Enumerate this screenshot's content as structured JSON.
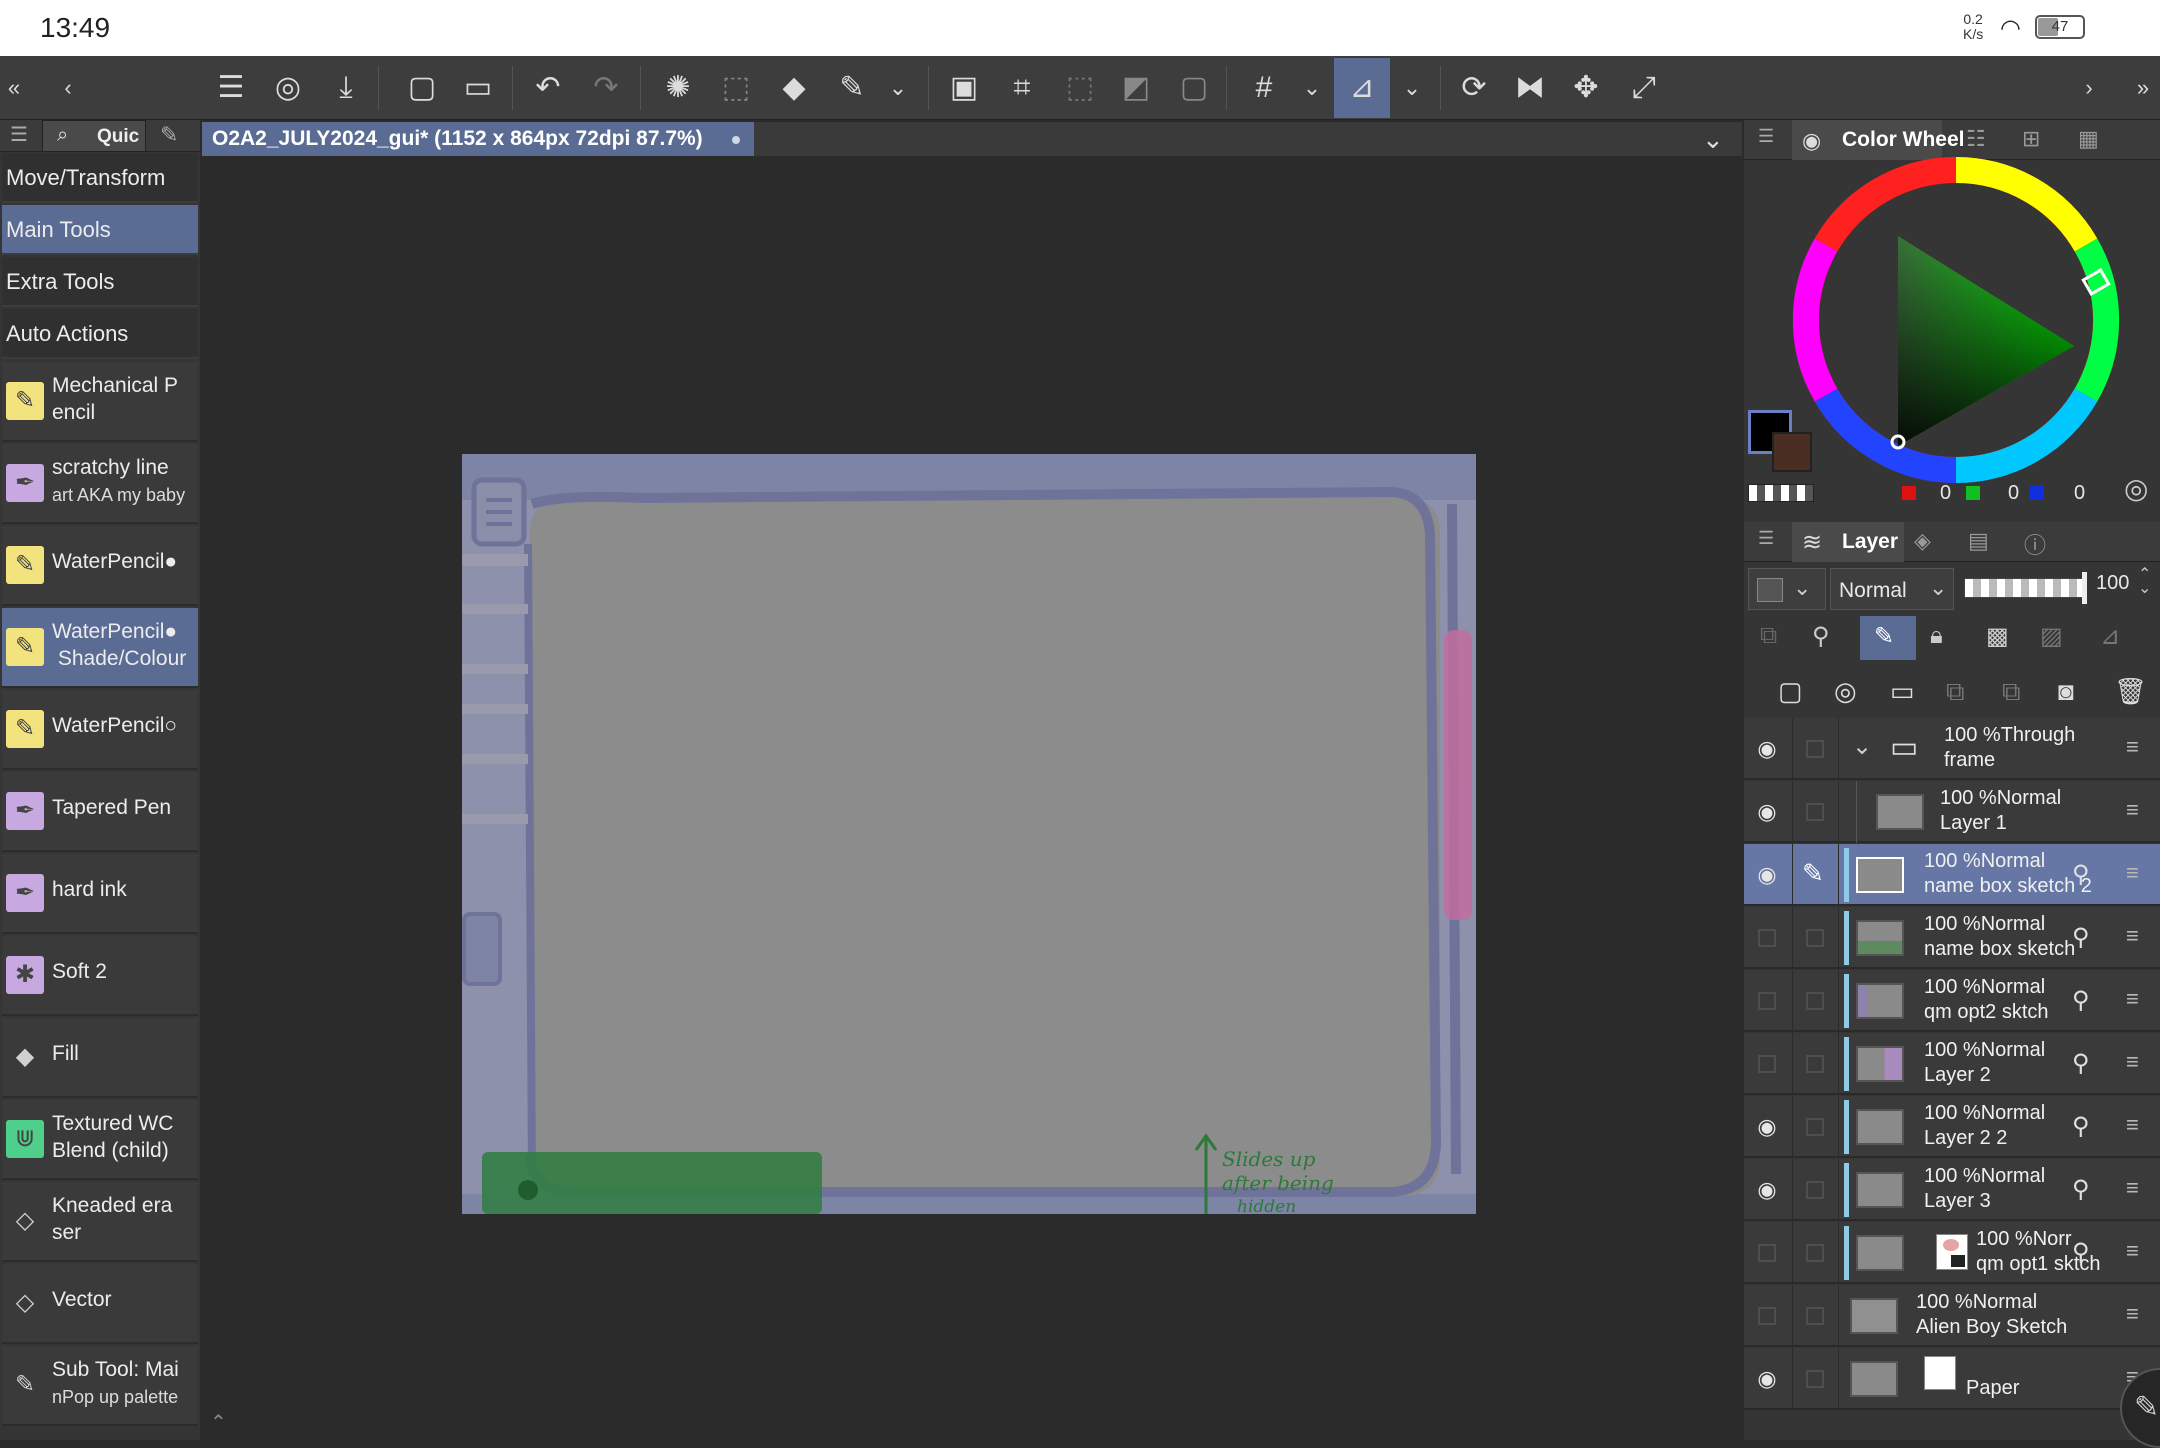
{
  "status_bar": {
    "time": "13:49",
    "net_speed": "0.2",
    "net_unit": "K/s",
    "battery": "47"
  },
  "document": {
    "tab_title": "O2A2_JULY2024_gui* (1152 x 864px 72dpi 87.7%)"
  },
  "left_panel": {
    "tab_label": "Quic",
    "categories": [
      "Move/Transform",
      "Main Tools",
      "Extra Tools",
      "Auto Actions"
    ],
    "tools": [
      {
        "line1": "Mechanical P",
        "line2": "encil"
      },
      {
        "line1": "scratchy line",
        "line2": "art AKA my baby"
      },
      {
        "line1": "WaterPencil●",
        "line2": ""
      },
      {
        "line1": "WaterPencil●",
        "line2": "Shade/Colour"
      },
      {
        "line1": "WaterPencil○",
        "line2": ""
      },
      {
        "line1": "Tapered Pen",
        "line2": ""
      },
      {
        "line1": "hard ink",
        "line2": ""
      },
      {
        "line1": "Soft 2",
        "line2": ""
      },
      {
        "line1": "Fill",
        "line2": ""
      },
      {
        "line1": "Textured WC",
        "line2": "Blend (child)"
      },
      {
        "line1": "Kneaded era",
        "line2": "ser"
      },
      {
        "line1": "Vector",
        "line2": ""
      },
      {
        "line1": "Sub Tool: Mai",
        "line2": "nPop up palette"
      }
    ]
  },
  "color_panel": {
    "title": "Color Wheel",
    "rgb": {
      "r": "0",
      "g": "0",
      "b": "0"
    }
  },
  "layer_panel": {
    "title": "Layer",
    "blend_mode": "Normal",
    "opacity": "100",
    "layers": [
      {
        "line1": "100 %Through",
        "line2": "frame",
        "visible": true,
        "type": "folder"
      },
      {
        "line1": "100 %Normal",
        "line2": "Layer 1",
        "visible": true,
        "type": "child"
      },
      {
        "line1": "100 %Normal",
        "line2": "name box sketch 2",
        "visible": true,
        "type": "clip",
        "selected": true
      },
      {
        "line1": "100 %Normal",
        "line2": "name box sketch",
        "visible": false,
        "type": "clip"
      },
      {
        "line1": "100 %Normal",
        "line2": "qm opt2 sktch",
        "visible": false,
        "type": "clip"
      },
      {
        "line1": "100 %Normal",
        "line2": "Layer 2",
        "visible": false,
        "type": "clip"
      },
      {
        "line1": "100 %Normal",
        "line2": "Layer 2 2",
        "visible": true,
        "type": "clip"
      },
      {
        "line1": "100 %Normal",
        "line2": "Layer 3",
        "visible": true,
        "type": "clip"
      },
      {
        "line1": "100 %Norr",
        "line2": "qm opt1 sktch",
        "visible": false,
        "type": "clip-mask"
      },
      {
        "line1": "100 %Normal",
        "line2": "Alien Boy Sketch",
        "visible": false,
        "type": "plain"
      },
      {
        "line1": "",
        "line2": "Paper",
        "visible": true,
        "type": "paper"
      }
    ]
  },
  "canvas_note": {
    "line1": "Slides up",
    "line2": "after being",
    "line3": "hidden"
  },
  "colors": {
    "accent": "#5b6c94",
    "panel": "#353535",
    "canvas_bg": "#2b2b2b",
    "clip_bar": "#8ecbe6"
  }
}
